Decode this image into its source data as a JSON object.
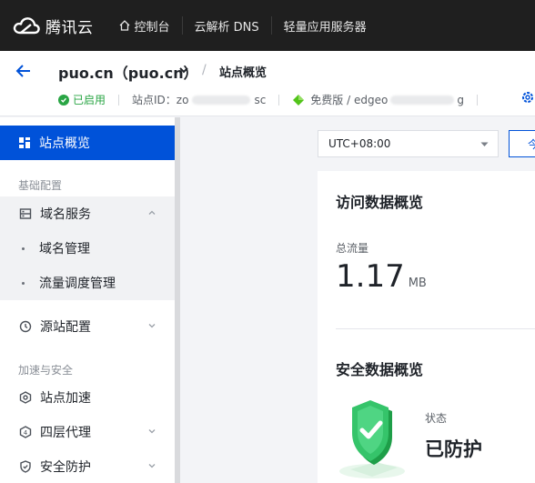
{
  "topnav": {
    "brand": "腾讯云",
    "items": [
      {
        "label": "控制台",
        "icon": "home-icon"
      },
      {
        "label": "云解析 DNS"
      },
      {
        "label": "轻量应用服务器"
      }
    ]
  },
  "header": {
    "site_title": "puo.cn（puo.cn）",
    "breadcrumb": "站点概览",
    "status": "已启用",
    "site_id_label": "站点ID：",
    "site_id_prefix": "zo",
    "site_id_suffix": "sc",
    "plan_label": "免费版 / edgeo",
    "plan_suffix": "g"
  },
  "sidebar": {
    "active": {
      "label": "站点概览",
      "icon": "dashboard-icon"
    },
    "group_basic": "基础配置",
    "group_speed_security": "加速与安全",
    "items": [
      {
        "label": "域名服务",
        "icon": "domain-icon"
      },
      {
        "label": "域名管理"
      },
      {
        "label": "流量调度管理"
      },
      {
        "label": "源站配置",
        "icon": "origin-icon"
      },
      {
        "label": "站点加速",
        "icon": "accelerate-icon"
      },
      {
        "label": "四层代理",
        "icon": "proxy-icon"
      },
      {
        "label": "安全防护",
        "icon": "shield-icon"
      }
    ]
  },
  "main": {
    "timezone": "UTC+08:00",
    "today_button": "今",
    "access_card": {
      "title": "访问数据概览",
      "metric_label": "总流量",
      "metric_value": "1.17",
      "metric_unit": "MB"
    },
    "security_card": {
      "title": "安全数据概览",
      "state_label": "状态",
      "state_value": "已防护"
    }
  },
  "colors": {
    "primary": "#0052d9",
    "success": "#29a544",
    "topnav_bg": "#1f1f1f"
  }
}
